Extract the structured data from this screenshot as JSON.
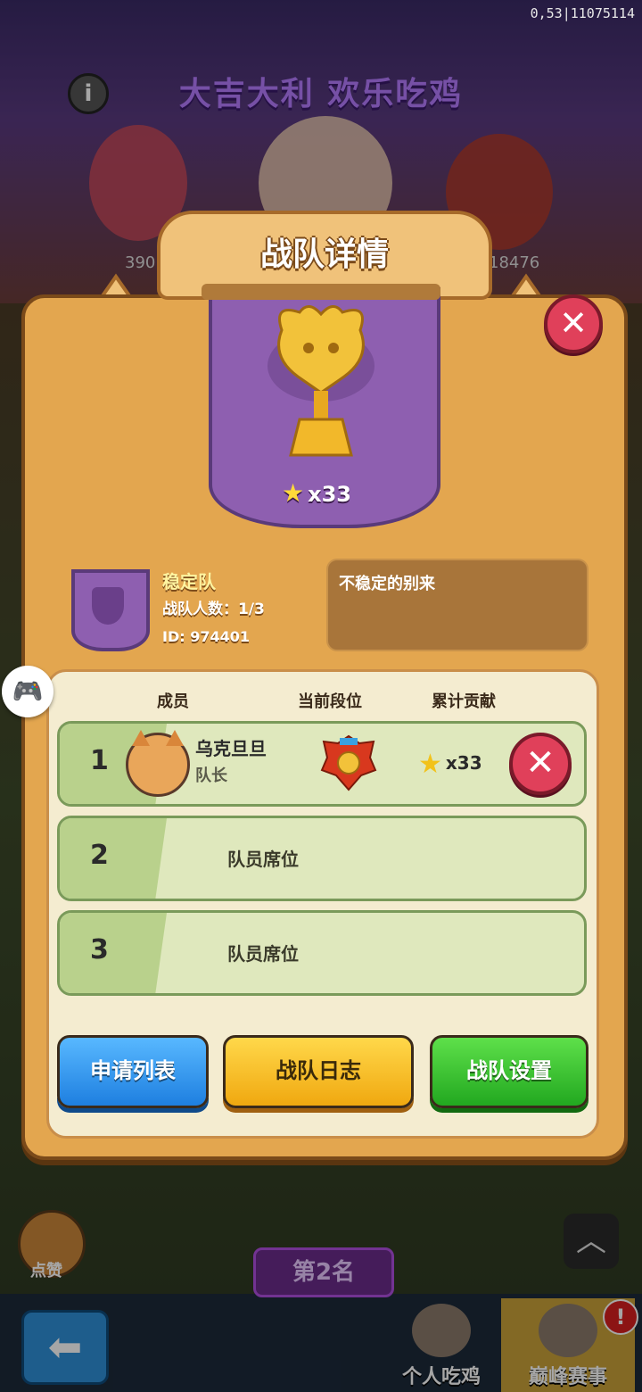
{
  "status": {
    "version": "0,53|11075114"
  },
  "background": {
    "banner": "大吉大利 欢乐吃鸡",
    "score_left": "390",
    "score_right": "18476",
    "like_label": "点赞",
    "rank_plate": "第2名",
    "nav": [
      {
        "label": "个人吃鸡",
        "active": false
      },
      {
        "label": "巅峰赛事",
        "active": true
      }
    ],
    "alert": "!"
  },
  "dialog": {
    "title": "战队详情",
    "trophy_stars": "x33",
    "team": {
      "name": "稳定队",
      "count_label": "战队人数：1/3",
      "id_label": "ID: 974401",
      "motto": "不稳定的别来"
    },
    "columns": {
      "member": "成员",
      "rank": "当前段位",
      "contribution": "累计贡献"
    },
    "members": [
      {
        "index": "1",
        "name": "乌克旦旦",
        "role": "队长",
        "contribution": "x33"
      }
    ],
    "empty_slots": [
      {
        "index": "2",
        "label": "队员席位"
      },
      {
        "index": "3",
        "label": "队员席位"
      }
    ],
    "buttons": {
      "apply_list": "申请列表",
      "team_log": "战队日志",
      "team_settings": "战队设置"
    }
  },
  "colors": {
    "accent_purple": "#8e5fb0",
    "panel": "#e3a64f",
    "close_red": "#e0405a"
  }
}
